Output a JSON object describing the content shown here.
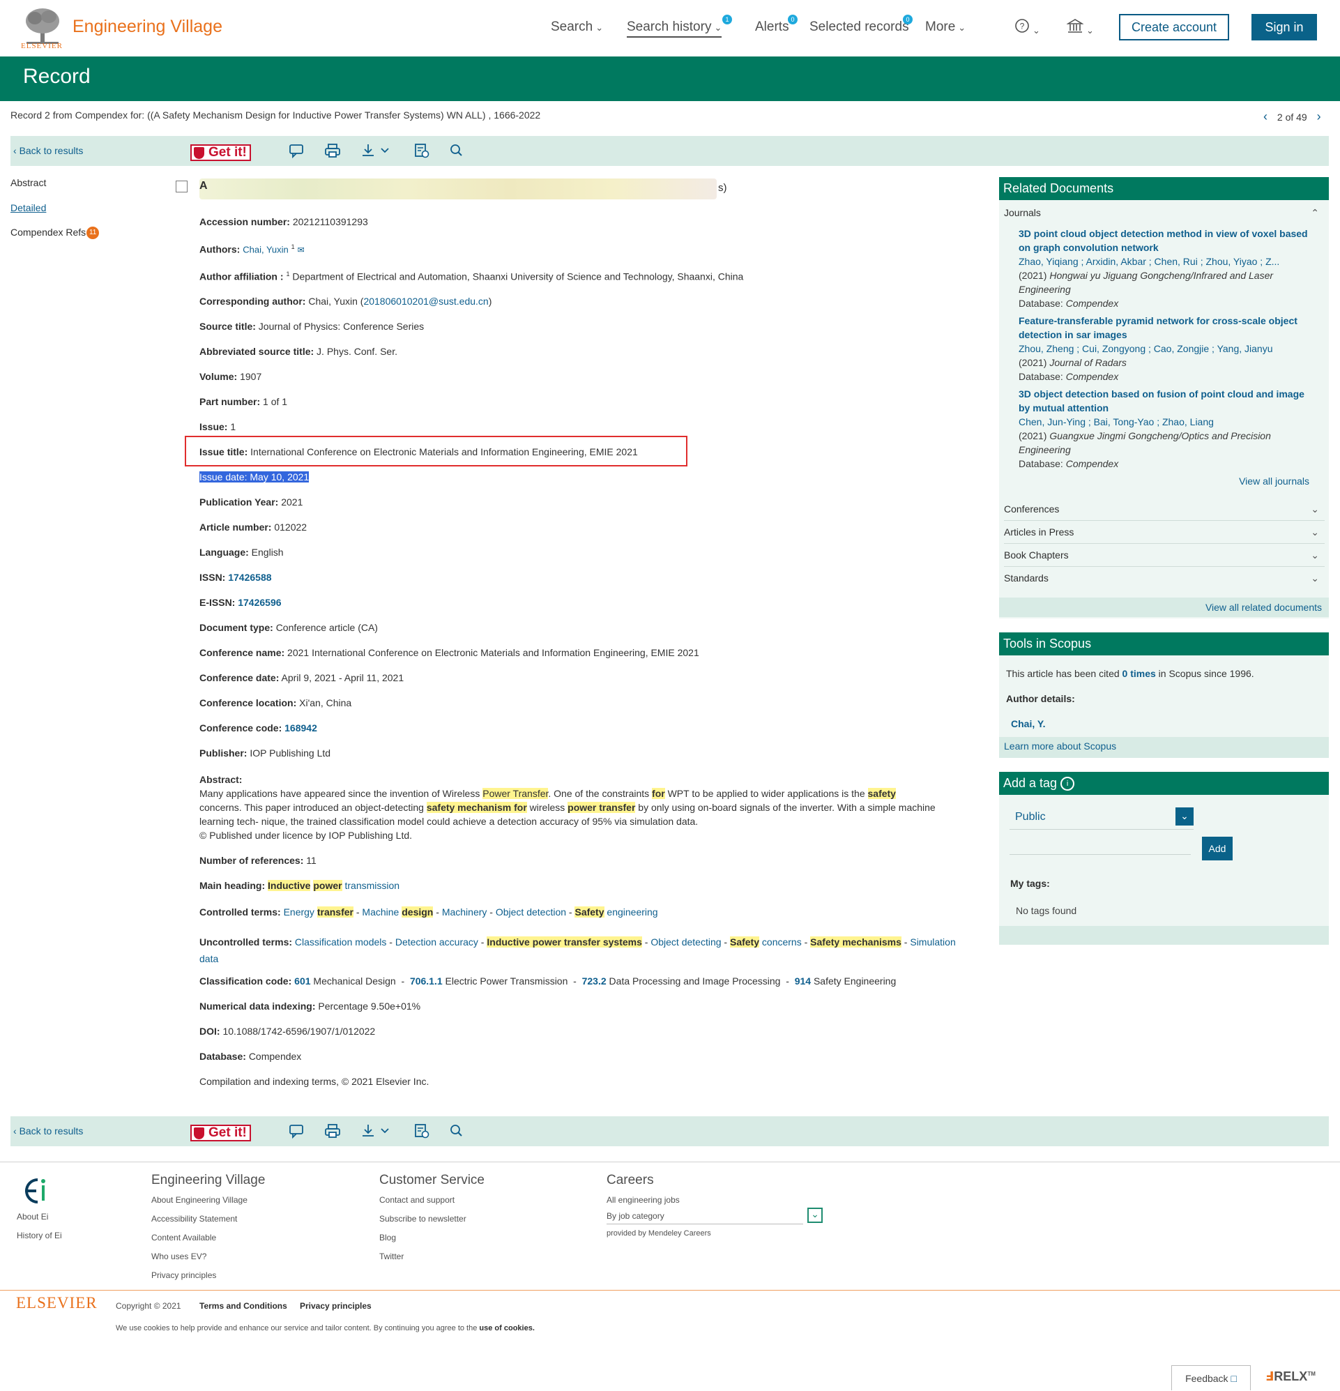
{
  "header": {
    "elsevier_small": "ELSEVIER",
    "app_title": "Engineering Village",
    "nav": {
      "search": "Search",
      "search_history": "Search history",
      "search_history_badge": "1",
      "alerts": "Alerts",
      "alerts_badge": "0",
      "selected_records": "Selected records",
      "selected_records_badge": "0",
      "more": "More"
    },
    "create_account": "Create account",
    "sign_in": "Sign in"
  },
  "banner": {
    "title": "Record"
  },
  "query_line": "Record 2 from Compendex for: ((A Safety Mechanism Design for Inductive Power Transfer Systems) WN ALL) , 1666-2022",
  "pager": {
    "label": "2 of 49"
  },
  "toolbar": {
    "back": "Back to results",
    "getit": "Get it!"
  },
  "left_nav": {
    "abstract": "Abstract",
    "detailed": "Detailed",
    "refs": "Compendex Refs",
    "refs_count": "11"
  },
  "record": {
    "title_start": "A",
    "title_end": "s)",
    "accession": {
      "label": "Accession number:",
      "value": "20212110391293"
    },
    "authors": {
      "label": "Authors:",
      "value": "Chai, Yuxin",
      "sup": "1"
    },
    "affiliation": {
      "label": "Author affiliation :",
      "sup": "1",
      "value": "Department of Electrical and Automation, Shaanxi University of Science and Technology, Shaanxi, China"
    },
    "corresponding": {
      "label": "Corresponding author:",
      "value": "Chai, Yuxin (",
      "email": "201806010201@sust.edu.cn",
      "close": ")"
    },
    "source_title": {
      "label": "Source title:",
      "value": "Journal of Physics: Conference Series"
    },
    "abbrev_source": {
      "label": "Abbreviated source title:",
      "value": "J. Phys. Conf. Ser."
    },
    "volume": {
      "label": "Volume:",
      "value": "1907"
    },
    "part": {
      "label": "Part number:",
      "value": "1 of 1"
    },
    "issue": {
      "label": "Issue:",
      "value": "1"
    },
    "issue_title": {
      "label": "Issue title:",
      "value": "International Conference on Electronic Materials and Information Engineering, EMIE 2021"
    },
    "issue_date": "Issue date: May 10, 2021",
    "pub_year": {
      "label": "Publication Year:",
      "value": "2021"
    },
    "article_number": {
      "label": "Article number:",
      "value": "012022"
    },
    "language": {
      "label": "Language:",
      "value": "English"
    },
    "issn": {
      "label": "ISSN:",
      "value": "17426588"
    },
    "eissn": {
      "label": "E-ISSN:",
      "value": "17426596"
    },
    "doc_type": {
      "label": "Document type:",
      "value": "Conference article (CA)"
    },
    "conf_name": {
      "label": "Conference name:",
      "value": "2021 International Conference on Electronic Materials and Information Engineering, EMIE 2021"
    },
    "conf_date": {
      "label": "Conference date:",
      "value": "April 9, 2021 - April 11, 2021"
    },
    "conf_location": {
      "label": "Conference location:",
      "value": "Xi'an, China"
    },
    "conf_code": {
      "label": "Conference code:",
      "value": "168942"
    },
    "publisher": {
      "label": "Publisher:",
      "value": "IOP Publishing Ltd"
    },
    "abstract": {
      "label": "Abstract:",
      "p1": "Many applications have appeared since the invention of Wireless ",
      "h1": "Power Transfer",
      "p2": ". One of the constraints ",
      "h2": "for",
      "p3": " WPT to be applied to wider applications is the ",
      "h3": "safety",
      "p4": " concerns. This paper introduced an object-detecting ",
      "h4": "safety mechanism for",
      "p5": " wireless ",
      "h5": "power transfer",
      "p6": " by only using on-board signals of the inverter. With a simple machine learning tech- nique, the trained classification model could achieve a detection accuracy of 95% via simulation data.",
      "p7": "© Published under licence by IOP Publishing Ltd."
    },
    "num_refs": {
      "label": "Number of references:",
      "value": "11"
    },
    "main_heading": {
      "label": "Main heading:",
      "h1": "Inductive",
      "h2": "power",
      "t": "transmission"
    },
    "controlled": {
      "label": "Controlled terms:",
      "t1": "Energy",
      "h1": "transfer",
      "h2": "Machine",
      "t2b": "design",
      "t3": "Machinery",
      "t4": "Object detection",
      "h5": "Safety",
      "t5": "engineering"
    },
    "uncontrolled": {
      "label": "Uncontrolled terms:",
      "t1": "Classification models",
      "t2": "Detection accuracy",
      "h3": "Inductive power transfer systems",
      "t4": "Object detecting",
      "h5": "Safety",
      "t5": "concerns",
      "h6": "Safety mechanisms",
      "t7": "Simulation data"
    },
    "classification": {
      "label": "Classification code:",
      "c1": "601",
      "d1": "Mechanical Design",
      "c2": "706.1.1",
      "d2": "Electric Power Transmission",
      "c3": "723.2",
      "d3": "Data Processing and Image Processing",
      "c4": "914",
      "d4": "Safety Engineering"
    },
    "numerical": {
      "label": "Numerical data indexing:",
      "value": "Percentage 9.50e+01%"
    },
    "doi": {
      "label": "DOI:",
      "value": "10.1088/1742-6596/1907/1/012022"
    },
    "database": {
      "label": "Database:",
      "value": "Compendex"
    },
    "compilation": "Compilation and indexing terms, © 2021 Elsevier Inc."
  },
  "related": {
    "head": "Related Documents",
    "journals": "Journals",
    "docs": [
      {
        "title": "3D point cloud object detection method in view of voxel based on graph convolution network",
        "authors": "Zhao, Yiqiang ; Arxidin, Akbar ; Chen, Rui ; Zhou, Yiyao ; Z...",
        "year": "(2021)",
        "journal": "Hongwai yu Jiguang Gongcheng/Infrared and Laser Engineering",
        "db_label": "Database:",
        "db": "Compendex"
      },
      {
        "title": "Feature-transferable pyramid network for cross-scale object detection in sar images",
        "authors": "Zhou, Zheng ; Cui, Zongyong ; Cao, Zongjie ; Yang, Jianyu",
        "year": "(2021)",
        "journal": "Journal of Radars",
        "db_label": "Database:",
        "db": "Compendex"
      },
      {
        "title": "3D object detection based on fusion of point cloud and image by mutual attention",
        "authors": "Chen, Jun-Ying ; Bai, Tong-Yao ; Zhao, Liang",
        "year": "(2021)",
        "journal": "Guangxue Jingmi Gongcheng/Optics and Precision Engineering",
        "db_label": "Database:",
        "db": "Compendex"
      }
    ],
    "view_all_journals": "View all journals",
    "conferences": "Conferences",
    "articles_in_press": "Articles in Press",
    "book_chapters": "Book Chapters",
    "standards": "Standards",
    "view_all_related": "View all related documents"
  },
  "scopus": {
    "head": "Tools in Scopus",
    "cited_a": "This article has been cited ",
    "cited_link": "0 times",
    "cited_b": " in Scopus since 1996.",
    "author_details": "Author details:",
    "author": "Chai, Y.",
    "learn_more": "Learn more about Scopus"
  },
  "tag": {
    "head": "Add a tag",
    "visibility": "Public",
    "add": "Add",
    "my_tags": "My tags:",
    "none": "No tags found"
  },
  "footer": {
    "ev_head": "Engineering Village",
    "ev_links": [
      "About Engineering Village",
      "Accessibility Statement",
      "Content Available",
      "Who uses EV?",
      "Privacy principles"
    ],
    "cs_head": "Customer Service",
    "cs_links": [
      "Contact and support",
      "Subscribe to newsletter",
      "Blog",
      "Twitter"
    ],
    "careers_head": "Careers",
    "careers_link": "All engineering jobs",
    "careers_select": "By job category",
    "careers_provided": "provided by Mendeley Careers",
    "about_ei": "About Ei",
    "history_ei": "History of Ei",
    "elsevier": "ELSEVIER",
    "copyright": "Copyright © 2021",
    "terms": "Terms and Conditions",
    "privacy": "Privacy principles",
    "cookies_a": "We use cookies to help provide and enhance our service and tailor content. By continuing you agree to the ",
    "cookies_b": "use of cookies.",
    "feedback": "Feedback",
    "relx": "RELX"
  },
  "colors": {
    "brand_green": "#00795f",
    "brand_orange": "#e9711c",
    "link_blue": "#0f5f8e",
    "highlight": "#fff48f"
  }
}
